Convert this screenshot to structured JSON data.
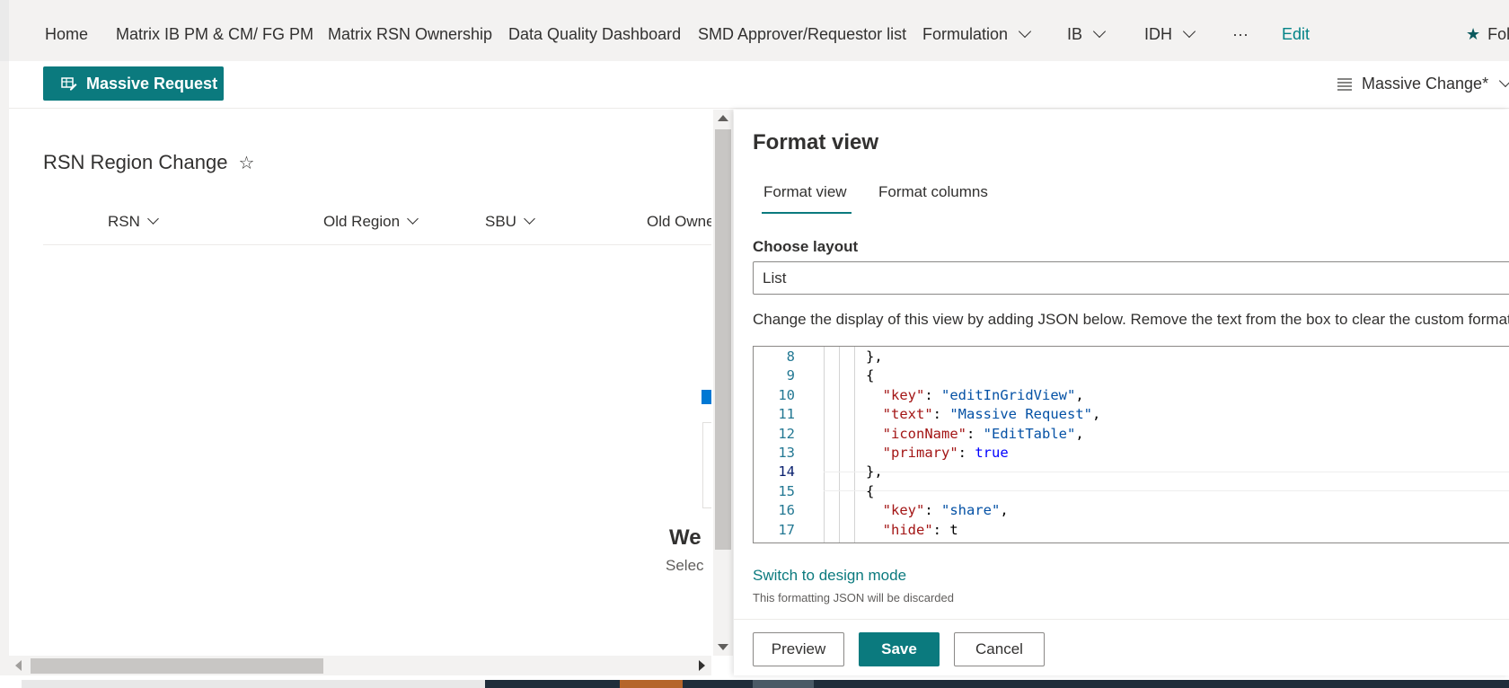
{
  "nav": {
    "items": [
      {
        "label": "Home"
      },
      {
        "label": "Matrix IB PM & CM/ FG PM"
      },
      {
        "label": "Matrix RSN Ownership"
      },
      {
        "label": "Data Quality Dashboard"
      },
      {
        "label": "SMD Approver/Requestor list"
      },
      {
        "label": "Formulation"
      },
      {
        "label": "IB"
      },
      {
        "label": "IDH"
      }
    ],
    "more": "···",
    "edit": "Edit",
    "follow": "Fol"
  },
  "command": {
    "massive_request": "Massive Request",
    "view_name": "Massive Change*"
  },
  "list": {
    "title": "RSN Region Change",
    "fav": "☆",
    "columns": [
      "RSN",
      "Old Region",
      "SBU",
      "Old Owne"
    ],
    "welcome": "We",
    "select": "Selec"
  },
  "panel": {
    "title": "Format view",
    "tabs": [
      "Format view",
      "Format columns"
    ],
    "choose_layout_label": "Choose layout",
    "layout_value": "List",
    "description": "Change the display of this view by adding JSON below. Remove the text from the box to clear the custom formatti",
    "code_lines": [
      {
        "n": "8",
        "indent": "",
        "parts": [
          {
            "t": "},",
            "c": "p"
          }
        ]
      },
      {
        "n": "9",
        "indent": "",
        "parts": [
          {
            "t": "{",
            "c": "p"
          }
        ]
      },
      {
        "n": "10",
        "indent": "  ",
        "parts": [
          {
            "t": "\"key\"",
            "c": "k"
          },
          {
            "t": ": ",
            "c": "p"
          },
          {
            "t": "\"editInGridView\"",
            "c": "s"
          },
          {
            "t": ",",
            "c": "p"
          }
        ]
      },
      {
        "n": "11",
        "indent": "  ",
        "parts": [
          {
            "t": "\"text\"",
            "c": "k"
          },
          {
            "t": ": ",
            "c": "p"
          },
          {
            "t": "\"Massive Request\"",
            "c": "s"
          },
          {
            "t": ",",
            "c": "p"
          }
        ]
      },
      {
        "n": "12",
        "indent": "  ",
        "parts": [
          {
            "t": "\"iconName\"",
            "c": "k"
          },
          {
            "t": ": ",
            "c": "p"
          },
          {
            "t": "\"EditTable\"",
            "c": "s"
          },
          {
            "t": ",",
            "c": "p"
          }
        ]
      },
      {
        "n": "13",
        "indent": "  ",
        "parts": [
          {
            "t": "\"primary\"",
            "c": "k"
          },
          {
            "t": ": ",
            "c": "p"
          },
          {
            "t": "true",
            "c": "b"
          }
        ]
      },
      {
        "n": "14",
        "indent": "",
        "parts": [
          {
            "t": "},",
            "c": "p"
          }
        ]
      },
      {
        "n": "15",
        "indent": "",
        "parts": [
          {
            "t": "{",
            "c": "p"
          }
        ]
      },
      {
        "n": "16",
        "indent": "  ",
        "parts": [
          {
            "t": "\"key\"",
            "c": "k"
          },
          {
            "t": ": ",
            "c": "p"
          },
          {
            "t": "\"share\"",
            "c": "s"
          },
          {
            "t": ",",
            "c": "p"
          }
        ]
      },
      {
        "n": "17",
        "indent": "  ",
        "parts": [
          {
            "t": "\"hide\"",
            "c": "k"
          },
          {
            "t": ": t",
            "c": "p"
          }
        ]
      }
    ],
    "current_line": "14",
    "switch_link": "Switch to design mode",
    "discard_note": "This formatting JSON will be discarded",
    "buttons": {
      "preview": "Preview",
      "save": "Save",
      "cancel": "Cancel"
    }
  },
  "colors": {
    "accent": "#0b7a7e",
    "nav_bg": "#f3f2f1"
  }
}
